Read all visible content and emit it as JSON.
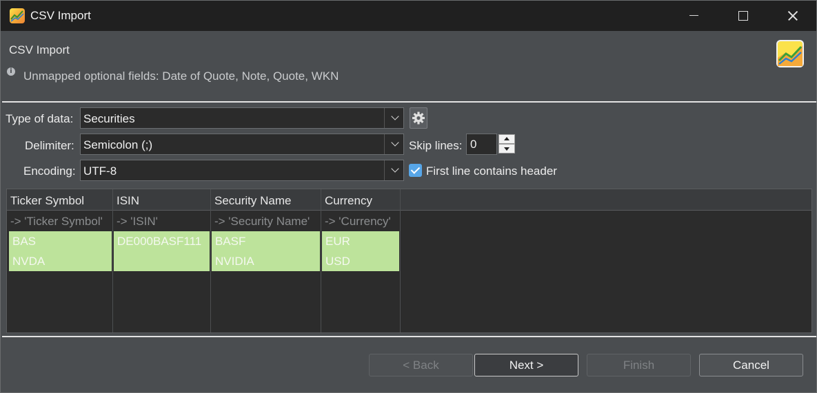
{
  "window": {
    "title": "CSV Import"
  },
  "header": {
    "title": "CSV Import",
    "message": "Unmapped optional fields: Date of Quote, Note, Quote, WKN"
  },
  "form": {
    "type_label": "Type of data:",
    "type_value": "Securities",
    "delimiter_label": "Delimiter:",
    "delimiter_value": "Semicolon (;)",
    "skip_label": "Skip lines:",
    "skip_value": "0",
    "encoding_label": "Encoding:",
    "encoding_value": "UTF-8",
    "first_line_label": "First line contains header",
    "first_line_checked": true
  },
  "table": {
    "columns": [
      "Ticker Symbol",
      "ISIN",
      "Security Name",
      "Currency"
    ],
    "mapping": [
      "-> 'Ticker Symbol'",
      "-> 'ISIN'",
      "-> 'Security Name'",
      "-> 'Currency'"
    ],
    "rows": [
      [
        "BAS",
        "DE000BASF111",
        "BASF",
        "EUR"
      ],
      [
        "NVDA",
        "",
        "NVIDIA",
        "USD"
      ]
    ],
    "highlight_color": "#bde39b"
  },
  "buttons": {
    "back": "< Back",
    "next": "Next >",
    "finish": "Finish",
    "cancel": "Cancel"
  },
  "icons": {
    "app": "portfolio-chart-icon",
    "info": "info-icon",
    "settings": "gear-icon"
  }
}
